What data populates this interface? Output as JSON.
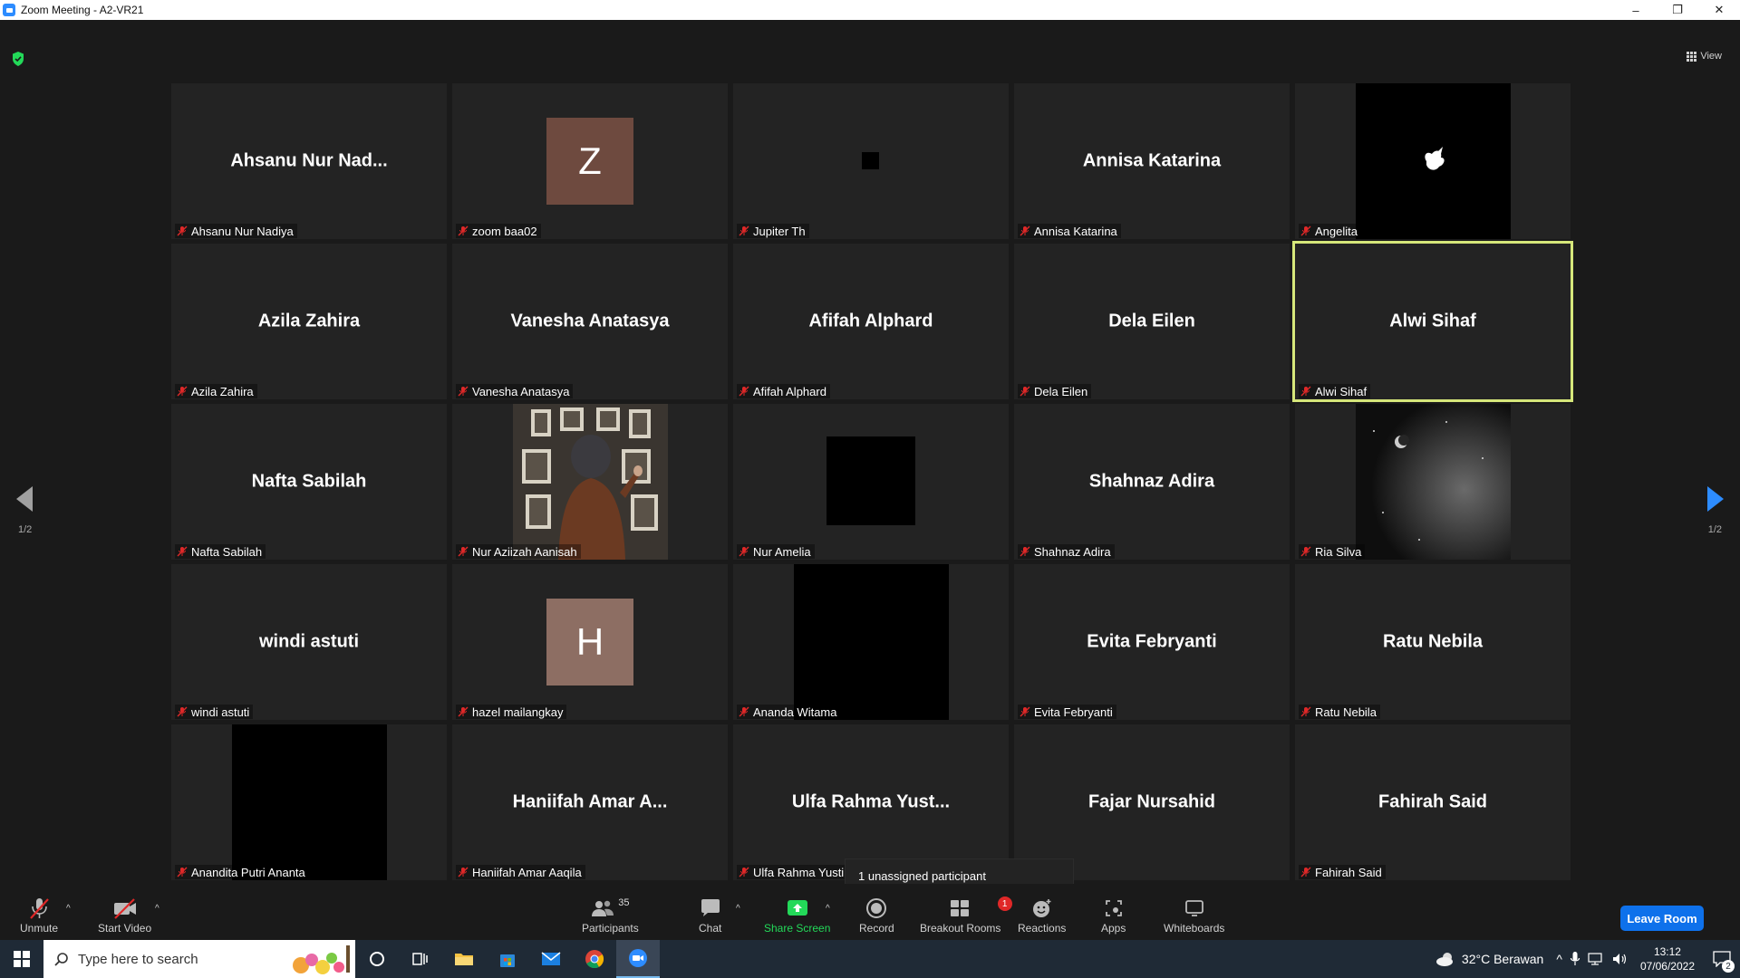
{
  "window": {
    "title": "Zoom Meeting - A2-VR21",
    "minimize": "–",
    "restore": "❐",
    "close": "✕"
  },
  "view_button": "View",
  "pagination": {
    "left": "1/2",
    "right": "1/2"
  },
  "tiles": [
    {
      "big_name": "Ahsanu Nur Nad...",
      "label": "Ahsanu Nur Nadiya"
    },
    {
      "avatar_letter": "Z",
      "avatar_color": "#6e4a3f",
      "label": "zoom baa02"
    },
    {
      "label": "Jupiter Th"
    },
    {
      "big_name": "Annisa Katarina",
      "label": "Annisa Katarina"
    },
    {
      "label": "Angelita"
    },
    {
      "big_name": "Azila Zahira",
      "label": "Azila Zahira"
    },
    {
      "big_name": "Vanesha Anatasya",
      "label": "Vanesha Anatasya"
    },
    {
      "big_name": "Afifah Alphard",
      "label": "Afifah Alphard"
    },
    {
      "big_name": "Dela Eilen",
      "label": "Dela Eilen"
    },
    {
      "big_name": "Alwi Sihaf",
      "label": "Alwi Sihaf"
    },
    {
      "big_name": "Nafta Sabilah",
      "label": "Nafta Sabilah"
    },
    {
      "label": "Nur Aziizah Aanisah"
    },
    {
      "label": "Nur Amelia"
    },
    {
      "big_name": "Shahnaz Adira",
      "label": "Shahnaz Adira"
    },
    {
      "label": "Ria Silva"
    },
    {
      "big_name": "windi astuti",
      "label": "windi astuti"
    },
    {
      "avatar_letter": "H",
      "avatar_color": "#8d6e63",
      "label": "hazel mailangkay"
    },
    {
      "label": "Ananda Witama"
    },
    {
      "big_name": "Evita Febryanti",
      "label": "Evita Febryanti"
    },
    {
      "big_name": "Ratu Nebila",
      "label": "Ratu Nebila"
    },
    {
      "label": "Anandita Putri Ananta"
    },
    {
      "big_name": "Haniifah Amar A...",
      "label": "Haniifah Amar Aaqila"
    },
    {
      "big_name": "Ulfa Rahma Yust...",
      "label": "Ulfa Rahma Yusti"
    },
    {
      "big_name": "Fajar Nursahid",
      "label": "rsahid"
    },
    {
      "big_name": "Fahirah Said",
      "label": "Fahirah Said"
    }
  ],
  "tooltip": "1 unassigned participant",
  "toolbar": {
    "unmute": "Unmute",
    "start_video": "Start Video",
    "participants": "Participants",
    "participants_count": "35",
    "chat": "Chat",
    "share_screen": "Share Screen",
    "record": "Record",
    "breakout_rooms": "Breakout Rooms",
    "breakout_badge": "1",
    "reactions": "Reactions",
    "apps": "Apps",
    "whiteboards": "Whiteboards",
    "leave": "Leave Room",
    "caret": "^"
  },
  "taskbar": {
    "search_placeholder": "Type here to search",
    "weather": "32°C  Berawan",
    "time": "13:12",
    "date": "07/06/2022",
    "notif_count": "2"
  },
  "colors": {
    "accent": "#2d8cff",
    "active_speaker": "#d6e77a",
    "share_green": "#23d959",
    "mic_off_red": "#e02828",
    "leave_blue": "#0e71eb"
  }
}
